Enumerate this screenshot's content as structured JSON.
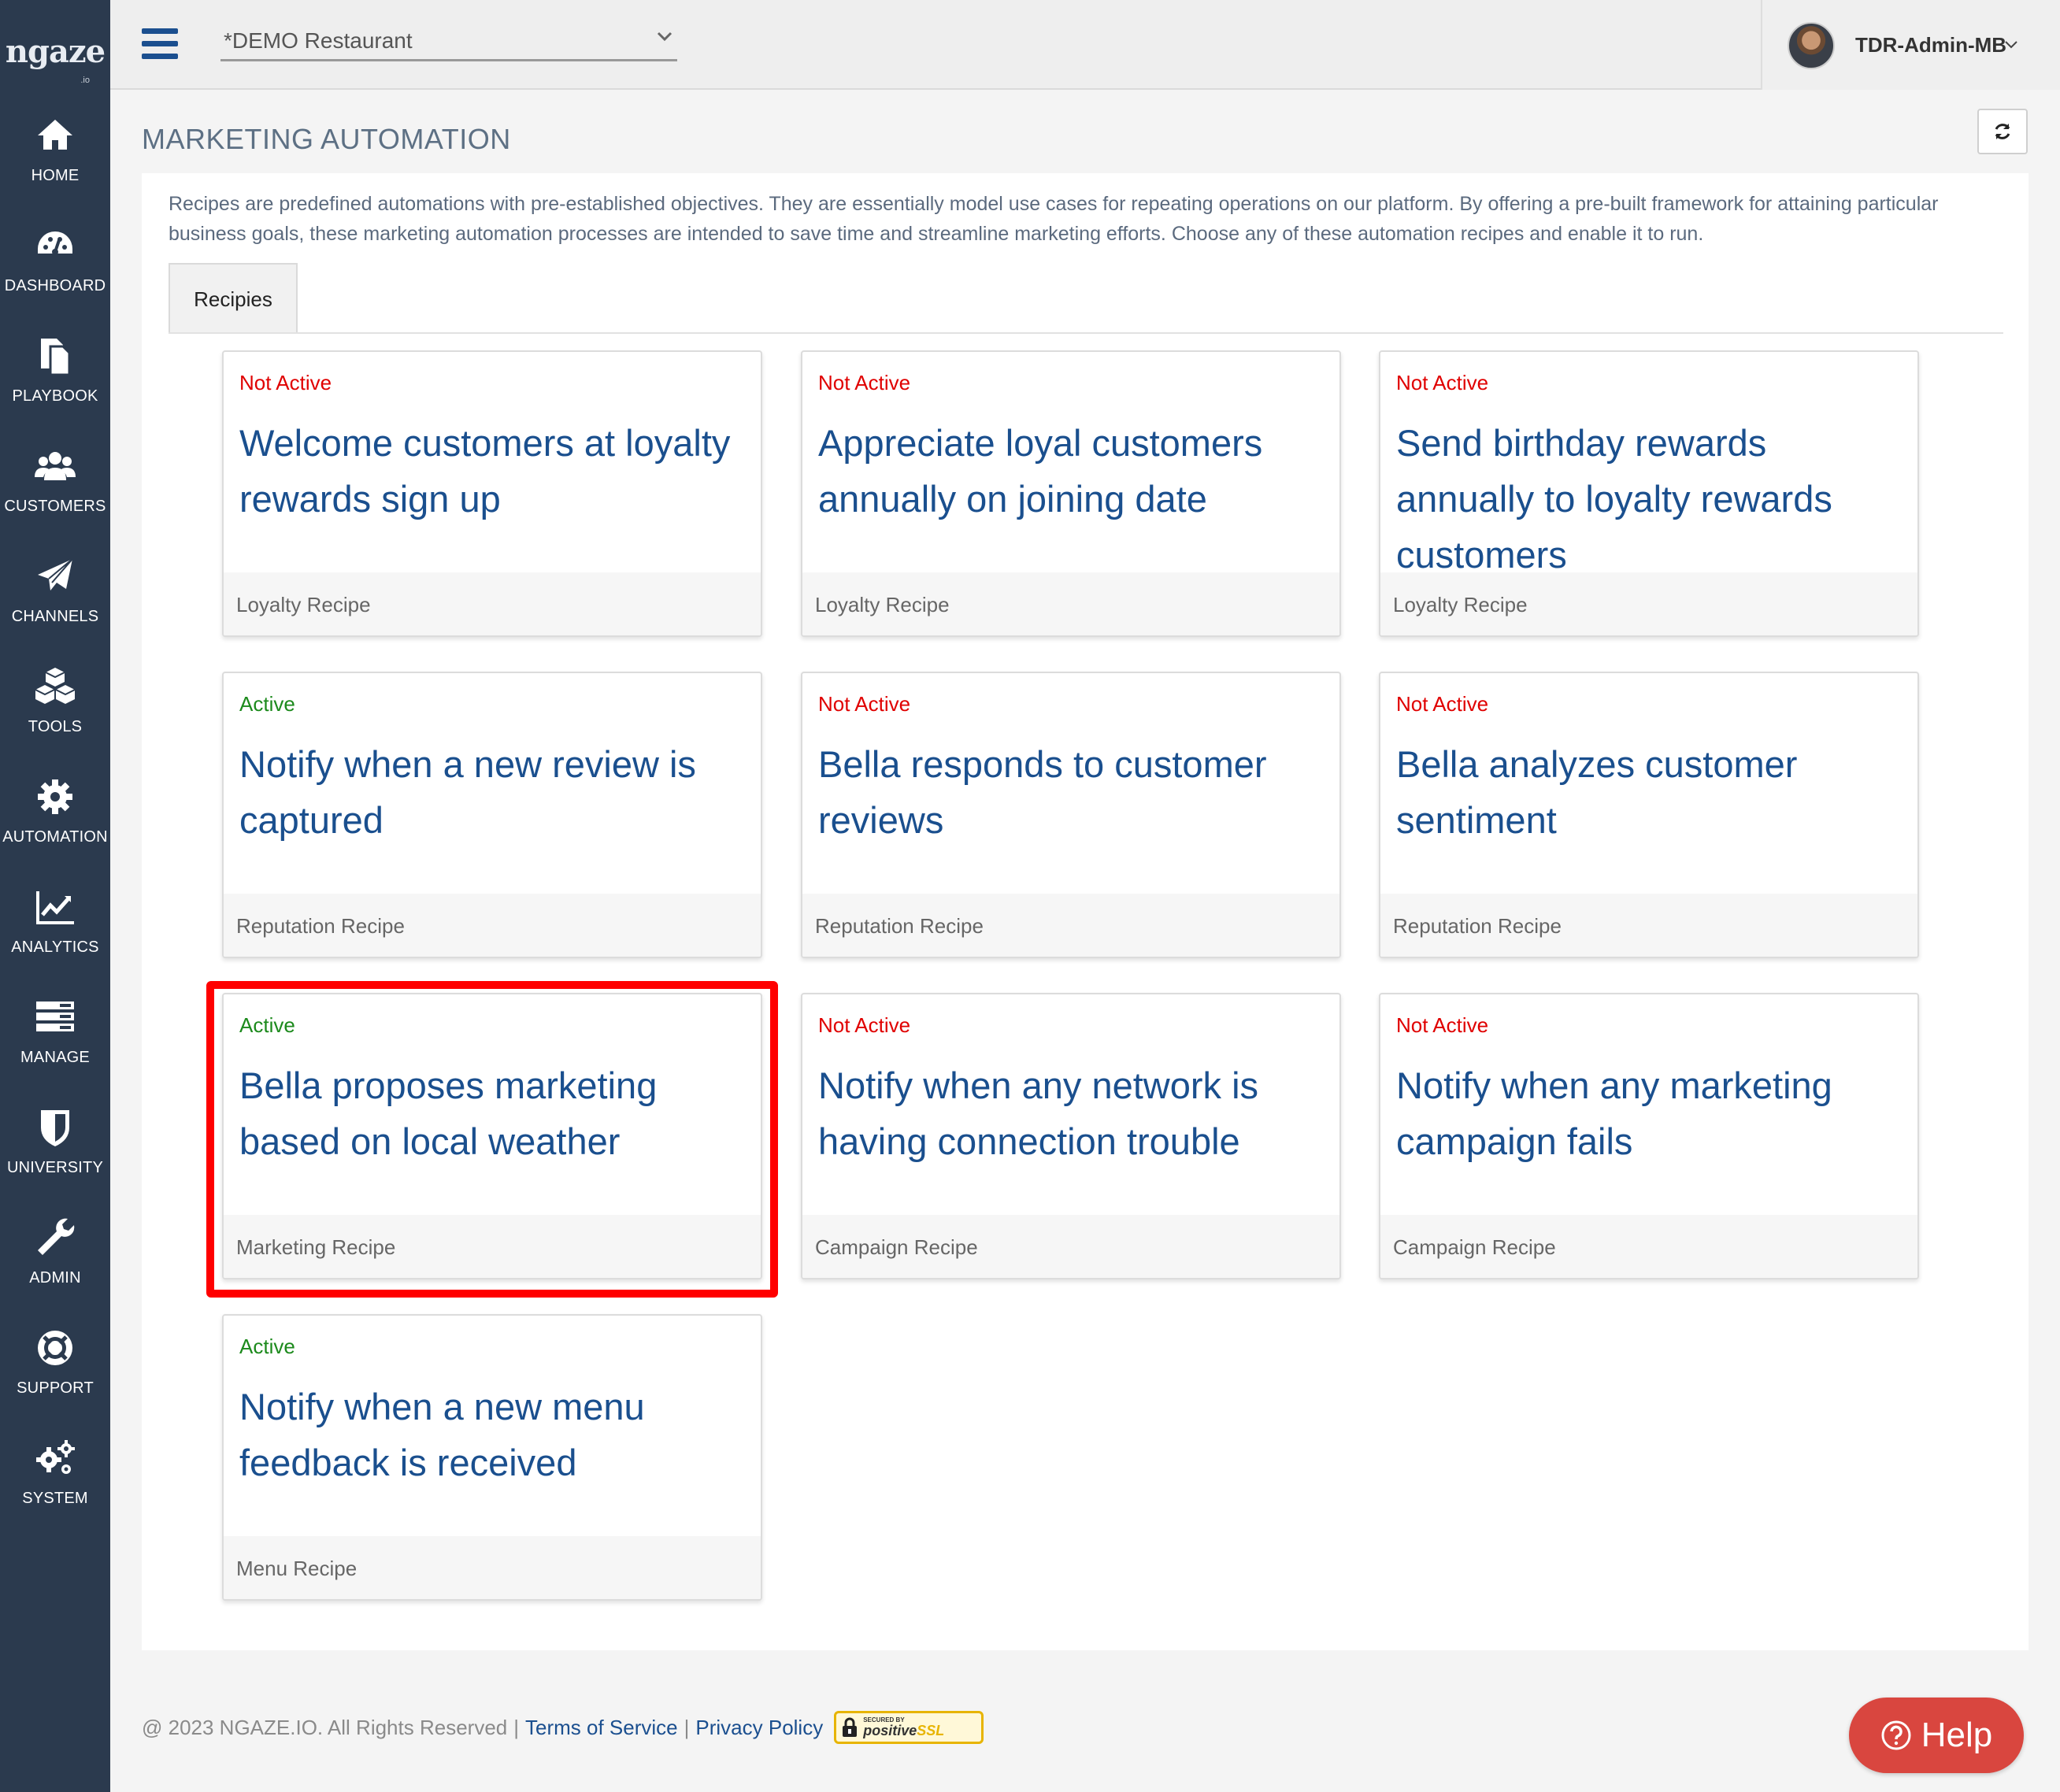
{
  "brand": {
    "logo_text": "ngaze",
    "logo_tld": ".io"
  },
  "nav": [
    {
      "label": "HOME",
      "icon": "home-icon"
    },
    {
      "label": "DASHBOARD",
      "icon": "dashboard-icon"
    },
    {
      "label": "PLAYBOOK",
      "icon": "playbook-icon"
    },
    {
      "label": "CUSTOMERS",
      "icon": "customers-icon"
    },
    {
      "label": "CHANNELS",
      "icon": "paper-plane-icon"
    },
    {
      "label": "TOOLS",
      "icon": "cubes-icon"
    },
    {
      "label": "AUTOMATION",
      "icon": "gear-icon"
    },
    {
      "label": "ANALYTICS",
      "icon": "line-chart-icon"
    },
    {
      "label": "MANAGE",
      "icon": "server-icon"
    },
    {
      "label": "UNIVERSITY",
      "icon": "shield-icon"
    },
    {
      "label": "ADMIN",
      "icon": "wrench-icon"
    },
    {
      "label": "SUPPORT",
      "icon": "life-ring-icon"
    },
    {
      "label": "SYSTEM",
      "icon": "gears-icon"
    }
  ],
  "topbar": {
    "restaurant": "*DEMO Restaurant",
    "username": "TDR-Admin-MB"
  },
  "page": {
    "title": "MARKETING AUTOMATION",
    "description": "Recipes are predefined automations with pre-established objectives. They are essentially model use cases for repeating operations on our platform. By offering a pre-built framework for attaining particular business goals, these marketing automation processes are intended to save time and streamline marketing efforts. Choose any of these automation recipes and enable it to run.",
    "tab_label": "Recipies"
  },
  "recipes": [
    {
      "status": "Not Active",
      "active": false,
      "title": "Welcome customers at loyalty rewards sign up",
      "category": "Loyalty Recipe"
    },
    {
      "status": "Not Active",
      "active": false,
      "title": "Appreciate loyal customers annually on joining date",
      "category": "Loyalty Recipe"
    },
    {
      "status": "Not Active",
      "active": false,
      "title": "Send birthday rewards annually to loyalty rewards customers",
      "category": "Loyalty Recipe"
    },
    {
      "status": "Active",
      "active": true,
      "title": "Notify when a new review is captured",
      "category": "Reputation Recipe"
    },
    {
      "status": "Not Active",
      "active": false,
      "title": "Bella responds to customer reviews",
      "category": "Reputation Recipe"
    },
    {
      "status": "Not Active",
      "active": false,
      "title": "Bella analyzes customer sentiment",
      "category": "Reputation Recipe"
    },
    {
      "status": "Active",
      "active": true,
      "title": "Bella proposes marketing based on local weather",
      "category": "Marketing Recipe"
    },
    {
      "status": "Not Active",
      "active": false,
      "title": "Notify when any network is having connection trouble",
      "category": "Campaign Recipe"
    },
    {
      "status": "Not Active",
      "active": false,
      "title": "Notify when any marketing campaign fails",
      "category": "Campaign Recipe"
    },
    {
      "status": "Active",
      "active": true,
      "title": "Notify when a new menu feedback is received",
      "category": "Menu Recipe"
    }
  ],
  "footer": {
    "copyright": "@ 2023 NGAZE.IO. All Rights Reserved",
    "sep": "|",
    "terms": "Terms of Service",
    "privacy": "Privacy Policy",
    "ssl_secured": "SECURED BY",
    "ssl_brand": "positive",
    "ssl_suffix": "SSL"
  },
  "help": {
    "label": "Help"
  },
  "colors": {
    "sidebar_bg": "#2b3a4e",
    "title_blue": "#1a4f8e",
    "not_active_red": "#e00000",
    "active_green": "#1c8a1c",
    "highlight_red": "#ff0000",
    "help_btn": "#d9463f"
  }
}
